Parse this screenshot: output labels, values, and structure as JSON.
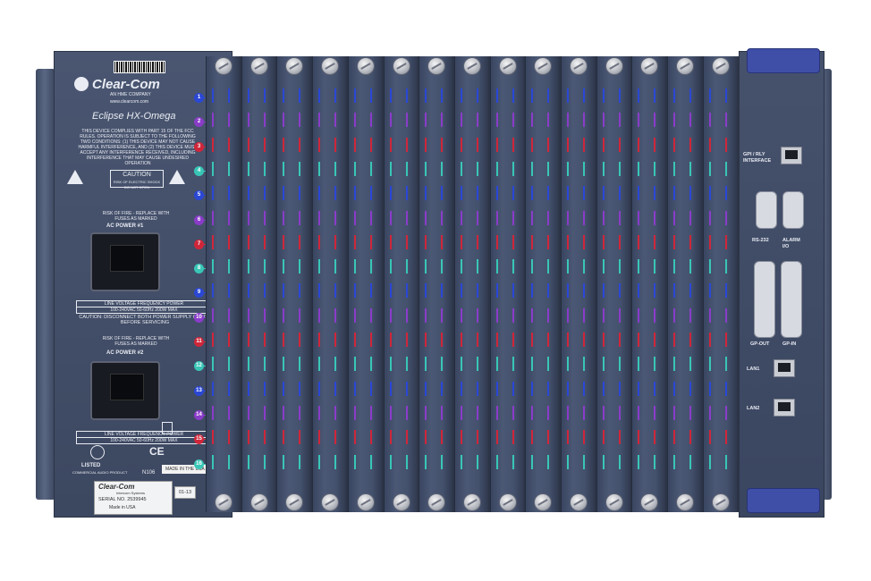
{
  "brand": {
    "name": "Clear-Com",
    "sub": "AN HME COMPANY",
    "url": "www.clearcom.com",
    "model": "Eclipse HX-Omega"
  },
  "fcc_text": "THIS DEVICE COMPLIES WITH PART 15 OF THE FCC RULES. OPERATION IS SUBJECT TO THE FOLLOWING TWO CONDITIONS: (1) THIS DEVICE MAY NOT CAUSE HARMFUL INTERFERENCE, AND (2) THIS DEVICE MUST ACCEPT ANY INTERFERENCE RECEIVED, INCLUDING INTERFERENCE THAT MAY CAUSE UNDESIRED OPERATION",
  "caution": {
    "title": "CAUTION",
    "sub": "RISK OF ELECTRIC SHOCK DO NOT OPEN"
  },
  "power1": {
    "warning": "RISK OF FIRE - REPLACE WITH FUSES AS MARKED",
    "label": "AC POWER #1",
    "table_header": "LINE VOLTAGE  FREQUENCY  POWER",
    "table_values": "100-240VAC  50-60Hz  200W MAX"
  },
  "disconnect_text": "CAUTION: DISCONNECT BOTH POWER SUPPLY CORDS BEFORE SERVICING",
  "power2": {
    "warning": "RISK OF FIRE - REPLACE WITH FUSES AS MARKED",
    "label": "AC POWER #2",
    "table_header": "LINE VOLTAGE  FREQUENCY  POWER",
    "table_values": "100-240VAC  50-60Hz  200W MAX"
  },
  "listing": {
    "listed": "LISTED",
    "product": "COMMERCIAL AUDIO PRODUCT",
    "code": "N106",
    "made": "MADE IN THE USA"
  },
  "serial_label": {
    "brand": "Clear-Com",
    "sub": "Intercom Systems",
    "serial": "SERIAL NO. 2539945",
    "made": "Made in USA",
    "date": "01-13"
  },
  "slot_numbers": [
    "1",
    "2",
    "3",
    "4",
    "5",
    "6",
    "7",
    "8",
    "9",
    "10",
    "11",
    "12",
    "13",
    "14",
    "15",
    "16"
  ],
  "colors": {
    "blue": "#2a47d6",
    "purple": "#8a3cc9",
    "red": "#d0263a",
    "teal": "#39c6b6"
  },
  "right_panel": {
    "gpi_rly": "GPI / RLY INTERFACE",
    "rs232": "RS-232",
    "alarm": "ALARM I/O",
    "gp_out": "GP-OUT",
    "gp_in": "GP-IN",
    "lan1": "LAN1",
    "lan2": "LAN2"
  },
  "icons": [
    "warning-icon",
    "barcode-icon",
    "clearcom-logo-icon",
    "ce-mark-icon",
    "weee-bin-icon",
    "ul-mark-icon"
  ]
}
